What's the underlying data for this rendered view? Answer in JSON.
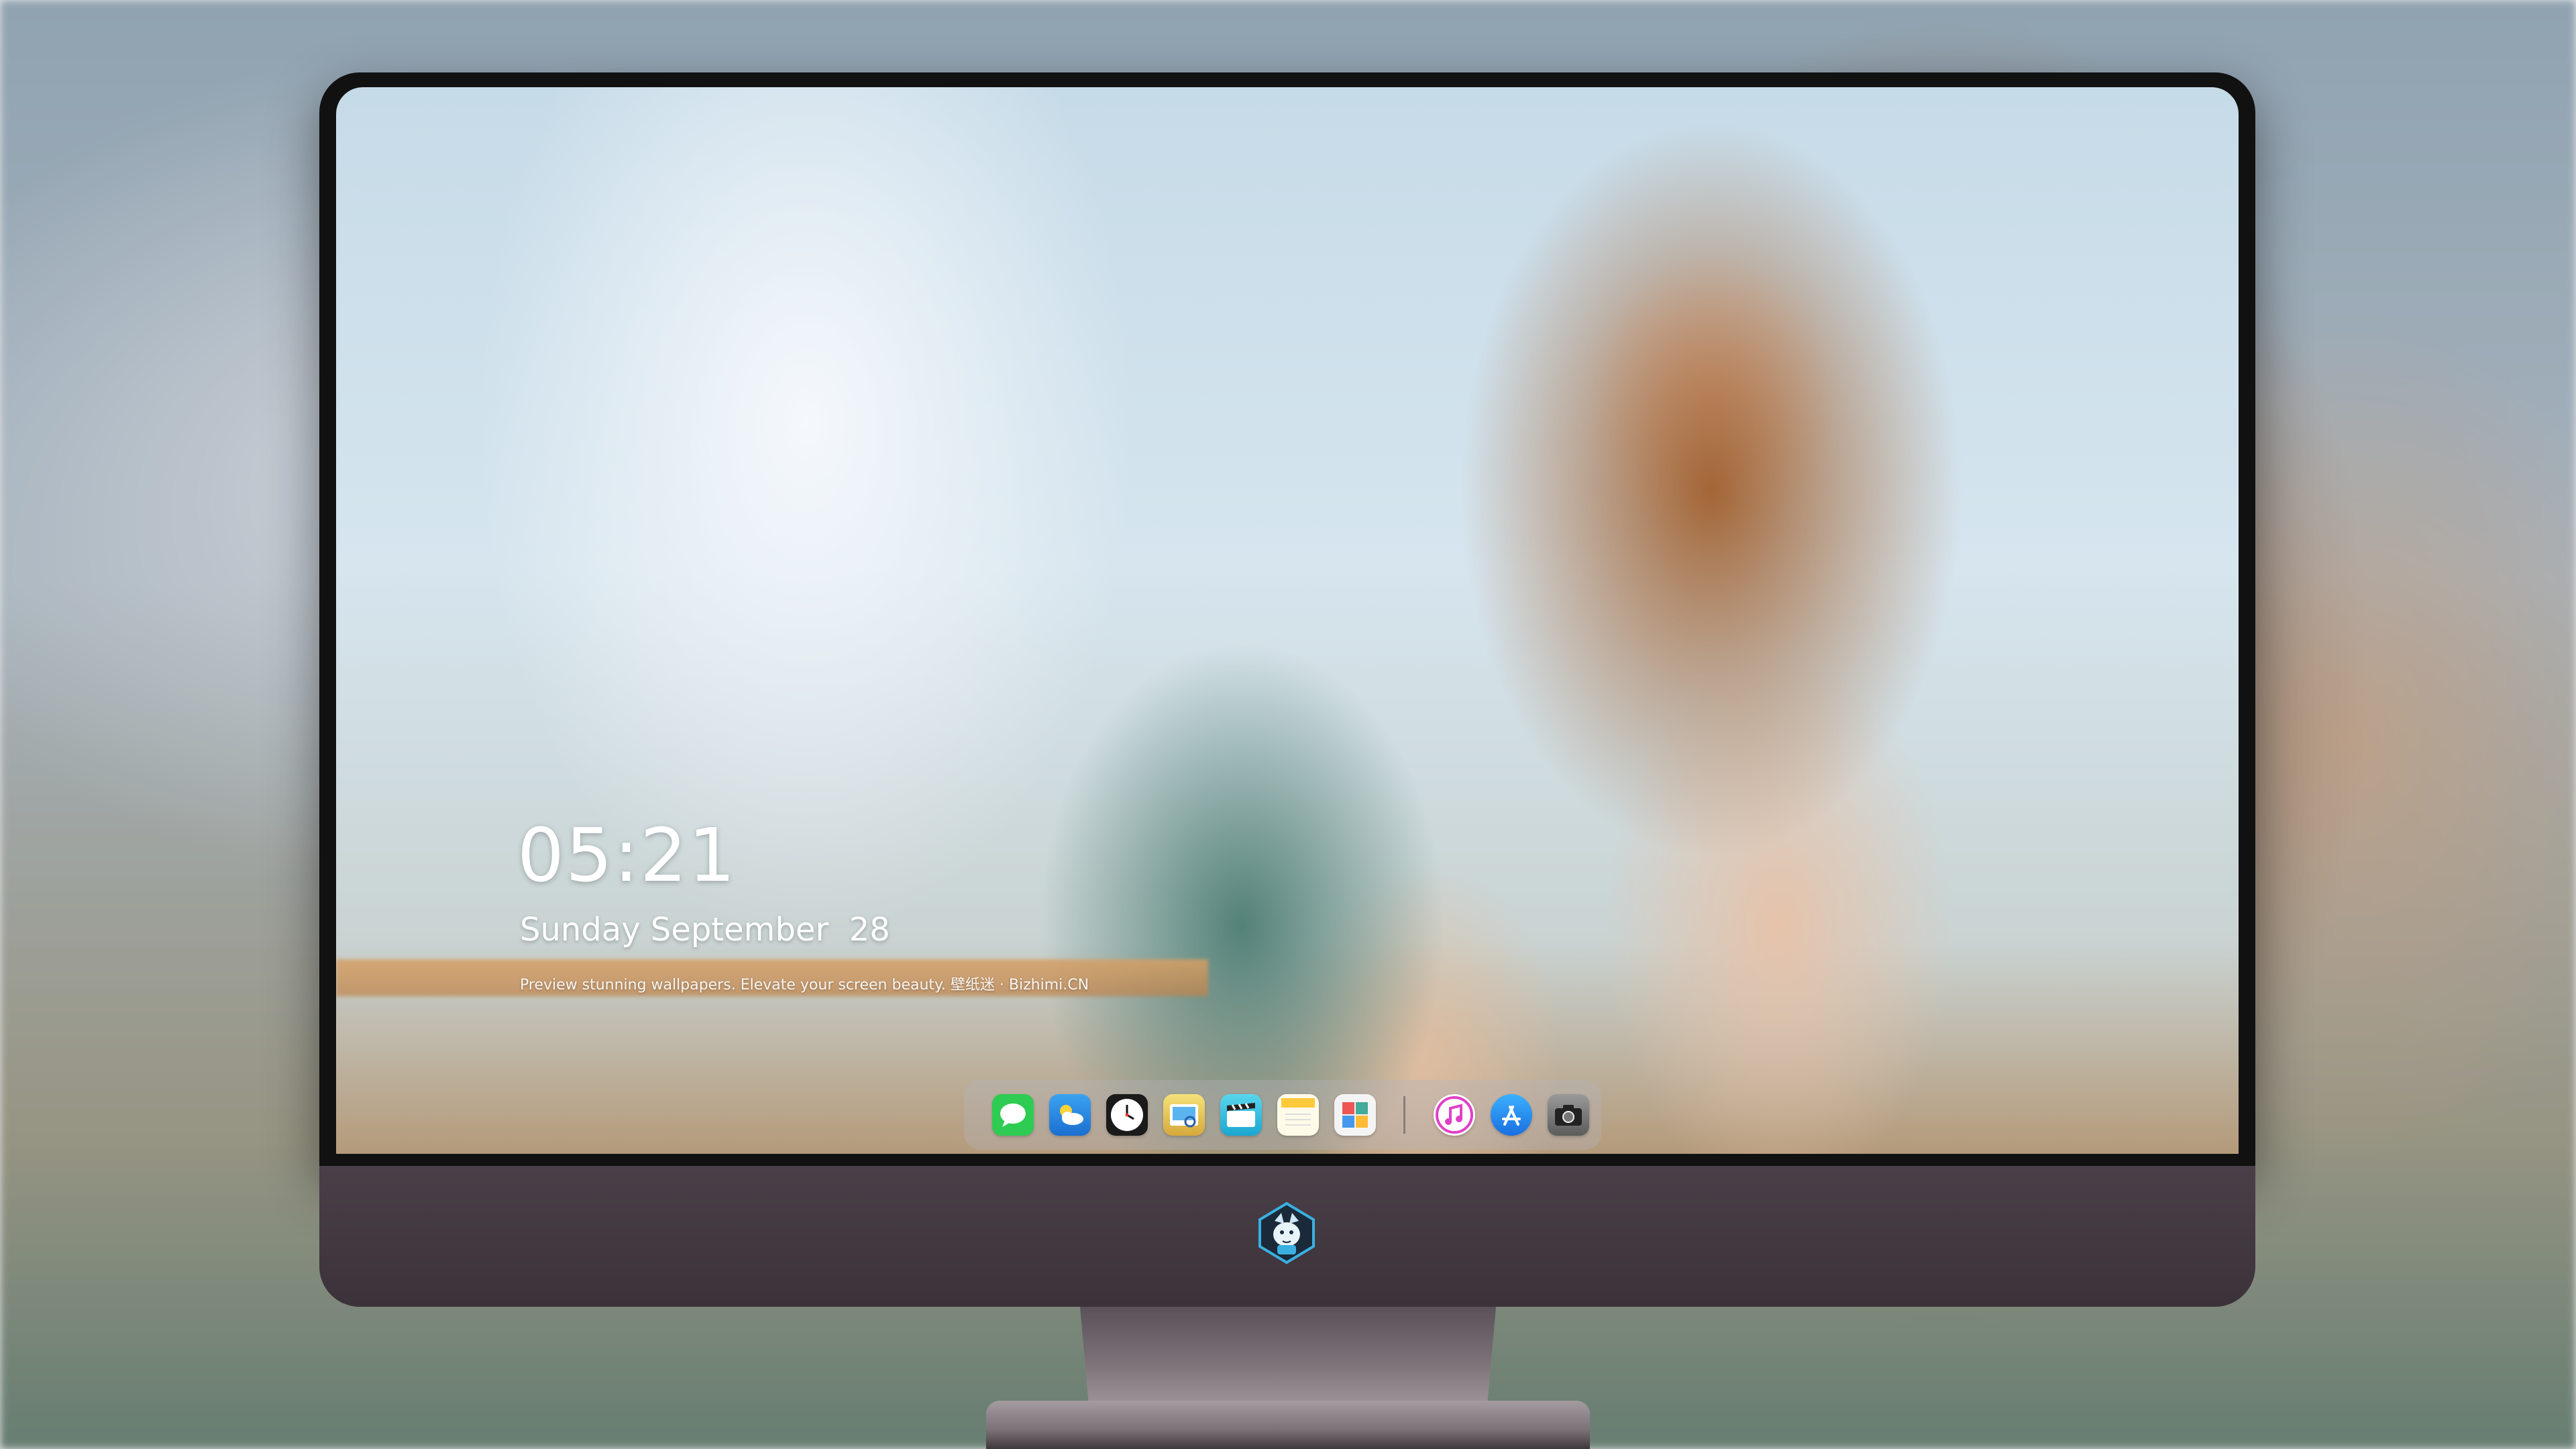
{
  "lockscreen": {
    "time": "05:21",
    "date": "Sunday September  28",
    "tagline": "Preview stunning wallpapers. Elevate your screen beauty. 壁纸迷 · Bizhimi.CN"
  },
  "dock": {
    "apps": [
      {
        "name": "messages-icon",
        "color": "#2ecc52"
      },
      {
        "name": "weather-icon",
        "color": "#3aa3f0"
      },
      {
        "name": "clock-icon",
        "color": "#ffffff"
      },
      {
        "name": "preview-icon",
        "color": "#e8c85a"
      },
      {
        "name": "video-editor-icon",
        "color": "#38c8e0"
      },
      {
        "name": "notes-icon",
        "color": "#ffd54a"
      },
      {
        "name": "photo-gallery-icon",
        "color": "#f0f0f0"
      },
      {
        "name": "music-icon",
        "color": "#e040c8"
      },
      {
        "name": "app-store-icon",
        "color": "#1e8ff0"
      },
      {
        "name": "camera-icon",
        "color": "#8a8a8a"
      }
    ]
  },
  "brand": {
    "logo": "wolf-mascot-icon"
  }
}
